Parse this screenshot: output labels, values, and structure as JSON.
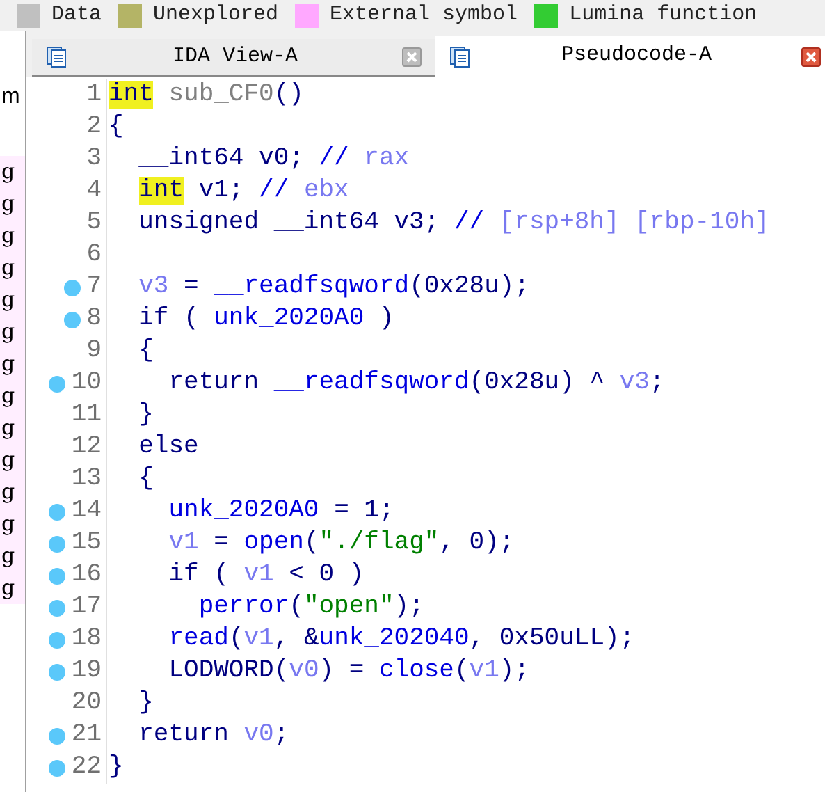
{
  "legend": [
    {
      "label": "Data",
      "color": "#c0c0c0"
    },
    {
      "label": "Unexplored",
      "color": "#b4b466"
    },
    {
      "label": "External symbol",
      "color": "#ffa8ff"
    },
    {
      "label": "Lumina function",
      "color": "#33cc33"
    }
  ],
  "side_panel": {
    "heading": "m",
    "rows": [
      "g",
      "g",
      "g",
      "g",
      "g",
      "g",
      "g",
      "g",
      "g",
      "g",
      "g",
      "g",
      "g",
      "g"
    ]
  },
  "tabs": [
    {
      "label": "IDA View-A",
      "selected": false
    },
    {
      "label": "Pseudocode-A",
      "selected": true
    }
  ],
  "code": [
    {
      "number": "1",
      "breakpoint": false,
      "tokens": [
        {
          "text": "int",
          "kind": "highlight"
        },
        {
          "text": " sub_CF0",
          "kind": "dim"
        },
        {
          "text": "()",
          "kind": "plain"
        }
      ]
    },
    {
      "number": "2",
      "breakpoint": false,
      "tokens": [
        {
          "text": "{",
          "kind": "plain"
        }
      ]
    },
    {
      "number": "3",
      "breakpoint": false,
      "tokens": [
        {
          "text": "  __int64 v0; ",
          "kind": "plain"
        },
        {
          "text": "// ",
          "kind": "name"
        },
        {
          "text": "rax",
          "kind": "var"
        }
      ]
    },
    {
      "number": "4",
      "breakpoint": false,
      "tokens": [
        {
          "text": "  int",
          "kind": "highlight"
        },
        {
          "text": " v1; ",
          "kind": "plain"
        },
        {
          "text": "// ",
          "kind": "name"
        },
        {
          "text": "ebx",
          "kind": "var"
        }
      ]
    },
    {
      "number": "5",
      "breakpoint": false,
      "tokens": [
        {
          "text": "  unsigned __int64 v3; ",
          "kind": "plain"
        },
        {
          "text": "// ",
          "kind": "name"
        },
        {
          "text": "[rsp+8h] [rbp-10h]",
          "kind": "var"
        }
      ]
    },
    {
      "number": "6",
      "breakpoint": false
    },
    {
      "number": "7",
      "breakpoint": true,
      "tokens": [
        {
          "text": "  v3",
          "kind": "var"
        },
        {
          "text": " = ",
          "kind": "plain"
        },
        {
          "text": "__readfsqword",
          "kind": "name"
        },
        {
          "text": "(0x28u);",
          "kind": "plain"
        }
      ]
    },
    {
      "number": "8",
      "breakpoint": true,
      "tokens": [
        {
          "text": "  if ( ",
          "kind": "plain"
        },
        {
          "text": "unk_2020A0",
          "kind": "name"
        },
        {
          "text": " )",
          "kind": "plain"
        }
      ]
    },
    {
      "number": "9",
      "breakpoint": false,
      "tokens": [
        {
          "text": "  {",
          "kind": "plain"
        }
      ]
    },
    {
      "number": "10",
      "breakpoint": true,
      "tokens": [
        {
          "text": "    return ",
          "kind": "plain"
        },
        {
          "text": "__readfsqword",
          "kind": "name"
        },
        {
          "text": "(0x28u) ^ ",
          "kind": "plain"
        },
        {
          "text": "v3",
          "kind": "var"
        },
        {
          "text": ";",
          "kind": "plain"
        }
      ]
    },
    {
      "number": "11",
      "breakpoint": false,
      "tokens": [
        {
          "text": "  }",
          "kind": "plain"
        }
      ]
    },
    {
      "number": "12",
      "breakpoint": false,
      "tokens": [
        {
          "text": "  else",
          "kind": "plain"
        }
      ]
    },
    {
      "number": "13",
      "breakpoint": false,
      "tokens": [
        {
          "text": "  {",
          "kind": "plain"
        }
      ]
    },
    {
      "number": "14",
      "breakpoint": true,
      "tokens": [
        {
          "text": "    unk_2020A0",
          "kind": "name"
        },
        {
          "text": " = 1;",
          "kind": "plain"
        }
      ]
    },
    {
      "number": "15",
      "breakpoint": true,
      "tokens": [
        {
          "text": "    v1",
          "kind": "var"
        },
        {
          "text": " = ",
          "kind": "plain"
        },
        {
          "text": "open",
          "kind": "name"
        },
        {
          "text": "(",
          "kind": "plain"
        },
        {
          "text": "\"./flag\"",
          "kind": "string"
        },
        {
          "text": ", 0);",
          "kind": "plain"
        }
      ]
    },
    {
      "number": "16",
      "breakpoint": true,
      "tokens": [
        {
          "text": "    if ( ",
          "kind": "plain"
        },
        {
          "text": "v1",
          "kind": "var"
        },
        {
          "text": " < 0 )",
          "kind": "plain"
        }
      ]
    },
    {
      "number": "17",
      "breakpoint": true,
      "tokens": [
        {
          "text": "      perror",
          "kind": "name"
        },
        {
          "text": "(",
          "kind": "plain"
        },
        {
          "text": "\"open\"",
          "kind": "string"
        },
        {
          "text": ");",
          "kind": "plain"
        }
      ]
    },
    {
      "number": "18",
      "breakpoint": true,
      "tokens": [
        {
          "text": "    read",
          "kind": "name"
        },
        {
          "text": "(",
          "kind": "plain"
        },
        {
          "text": "v1",
          "kind": "var"
        },
        {
          "text": ", &",
          "kind": "plain"
        },
        {
          "text": "unk_202040",
          "kind": "name"
        },
        {
          "text": ", 0x50uLL);",
          "kind": "plain"
        }
      ]
    },
    {
      "number": "19",
      "breakpoint": true,
      "tokens": [
        {
          "text": "    LODWORD(",
          "kind": "plain"
        },
        {
          "text": "v0",
          "kind": "var"
        },
        {
          "text": ") = ",
          "kind": "plain"
        },
        {
          "text": "close",
          "kind": "name"
        },
        {
          "text": "(",
          "kind": "plain"
        },
        {
          "text": "v1",
          "kind": "var"
        },
        {
          "text": ");",
          "kind": "plain"
        }
      ]
    },
    {
      "number": "20",
      "breakpoint": false,
      "tokens": [
        {
          "text": "  }",
          "kind": "plain"
        }
      ]
    },
    {
      "number": "21",
      "breakpoint": true,
      "tokens": [
        {
          "text": "  return ",
          "kind": "plain"
        },
        {
          "text": "v0",
          "kind": "var"
        },
        {
          "text": ";",
          "kind": "plain"
        }
      ]
    },
    {
      "number": "22",
      "breakpoint": true,
      "tokens": [
        {
          "text": "}",
          "kind": "plain"
        }
      ]
    }
  ]
}
